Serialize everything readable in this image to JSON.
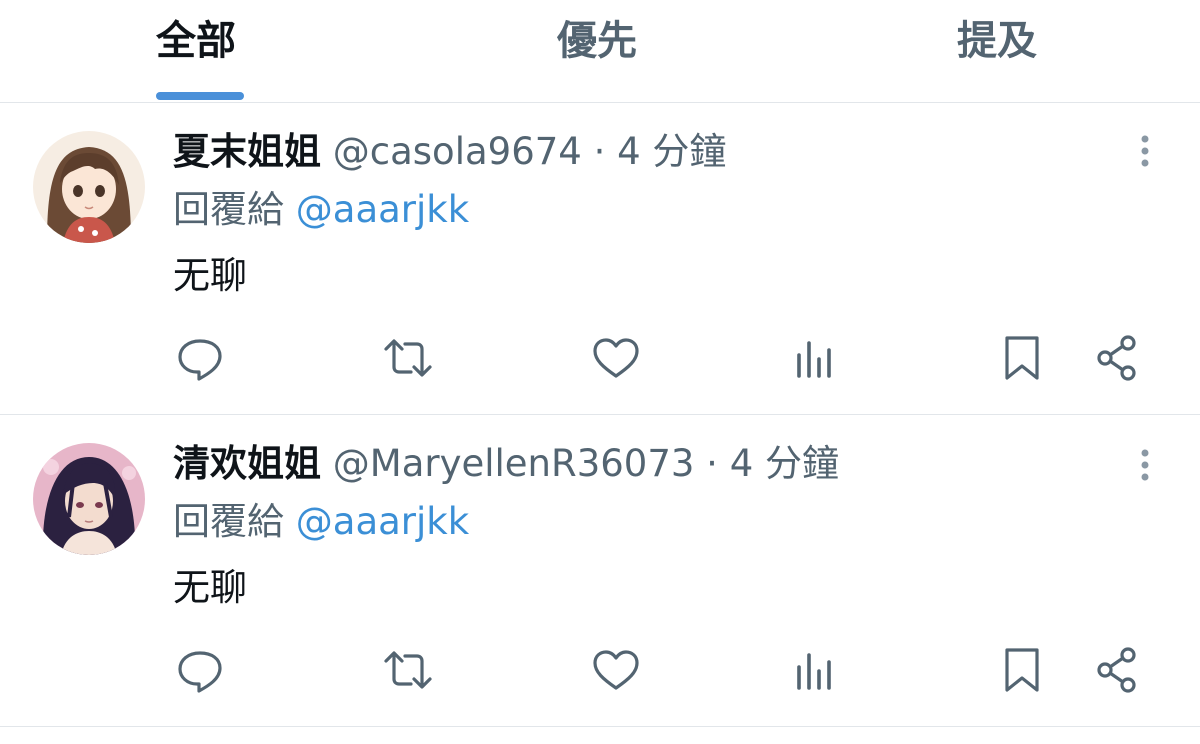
{
  "tabs": [
    {
      "label": "全部",
      "active": true
    },
    {
      "label": "優先",
      "active": false
    },
    {
      "label": "提及",
      "active": false
    }
  ],
  "colors": {
    "accent": "#4a90d9",
    "mention": "#3b8fd6",
    "text": "#0f1419",
    "secondary": "#536471",
    "divider": "#e2e6ea"
  },
  "tweets": [
    {
      "display_name": "夏末姐姐",
      "handle": "@casola9674",
      "separator": " · ",
      "time": "4 分鐘",
      "reply_prefix": "回覆給",
      "reply_to": "@aaarjkk",
      "text": "无聊",
      "avatar": "anime-girl-brown-hair-avatar"
    },
    {
      "display_name": "清欢姐姐",
      "handle": "@MaryellenR36073",
      "separator": " · ",
      "time": "4 分鐘",
      "reply_prefix": "回覆給",
      "reply_to": "@aaarjkk",
      "text": "无聊",
      "avatar": "anime-boy-dark-hair-avatar"
    }
  ],
  "actions": [
    "reply-icon",
    "retweet-icon",
    "like-icon",
    "views-icon",
    "bookmark-icon",
    "share-icon"
  ]
}
